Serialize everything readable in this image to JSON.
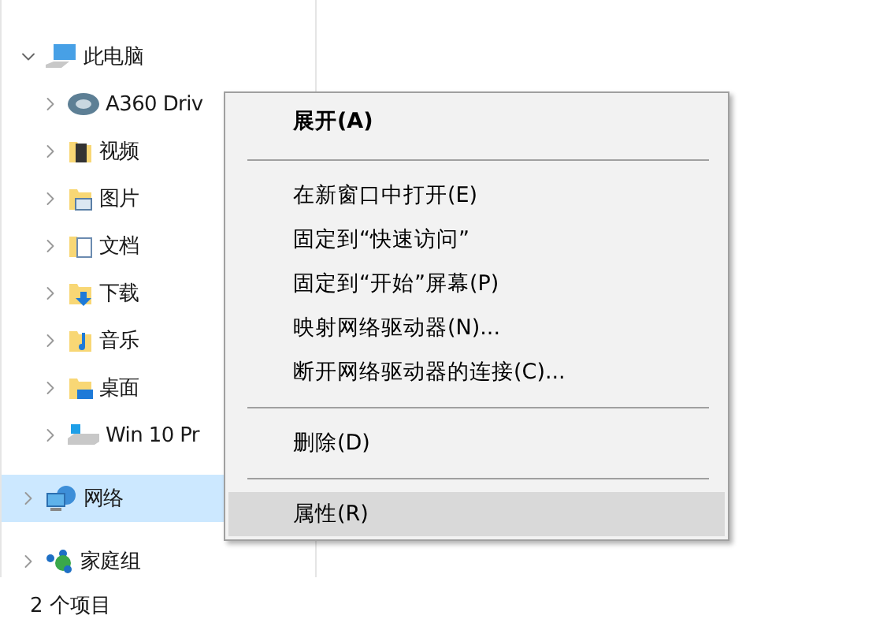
{
  "nav_tree": [
    {
      "label": "此电脑",
      "kind": "computer",
      "expanded": true,
      "selected": false,
      "children": [
        {
          "label": "A360 Driv",
          "kind": "a360",
          "expanded": false,
          "selected": false
        },
        {
          "label": "视频",
          "kind": "videos",
          "expanded": false,
          "selected": false
        },
        {
          "label": "图片",
          "kind": "pictures",
          "expanded": false,
          "selected": false
        },
        {
          "label": "文档",
          "kind": "documents",
          "expanded": false,
          "selected": false
        },
        {
          "label": "下载",
          "kind": "downloads",
          "expanded": false,
          "selected": false
        },
        {
          "label": "音乐",
          "kind": "music",
          "expanded": false,
          "selected": false
        },
        {
          "label": "桌面",
          "kind": "desktop",
          "expanded": false,
          "selected": false
        },
        {
          "label": "Win 10 Pr",
          "kind": "drive",
          "expanded": false,
          "selected": false
        }
      ]
    },
    {
      "label": "网络",
      "kind": "network",
      "expanded": false,
      "selected": true
    },
    {
      "label": "家庭组",
      "kind": "homegroup",
      "expanded": false,
      "selected": false
    }
  ],
  "context_menu": [
    {
      "kind": "item",
      "label": "展开(A)",
      "default": true,
      "selected": false
    },
    {
      "kind": "separator"
    },
    {
      "kind": "item",
      "label": "在新窗口中打开(E)",
      "default": false,
      "selected": false
    },
    {
      "kind": "item",
      "label": "固定到“快速访问”",
      "default": false,
      "selected": false
    },
    {
      "kind": "item",
      "label": "固定到“开始”屏幕(P)",
      "default": false,
      "selected": false
    },
    {
      "kind": "item",
      "label": "映射网络驱动器(N)...",
      "default": false,
      "selected": false
    },
    {
      "kind": "item",
      "label": "断开网络驱动器的连接(C)...",
      "default": false,
      "selected": false
    },
    {
      "kind": "separator"
    },
    {
      "kind": "item",
      "label": "删除(D)",
      "default": false,
      "selected": false
    },
    {
      "kind": "separator"
    },
    {
      "kind": "item",
      "label": "属性(R)",
      "default": false,
      "selected": true
    }
  ],
  "status_bar": {
    "item_count": "2 个项目"
  }
}
